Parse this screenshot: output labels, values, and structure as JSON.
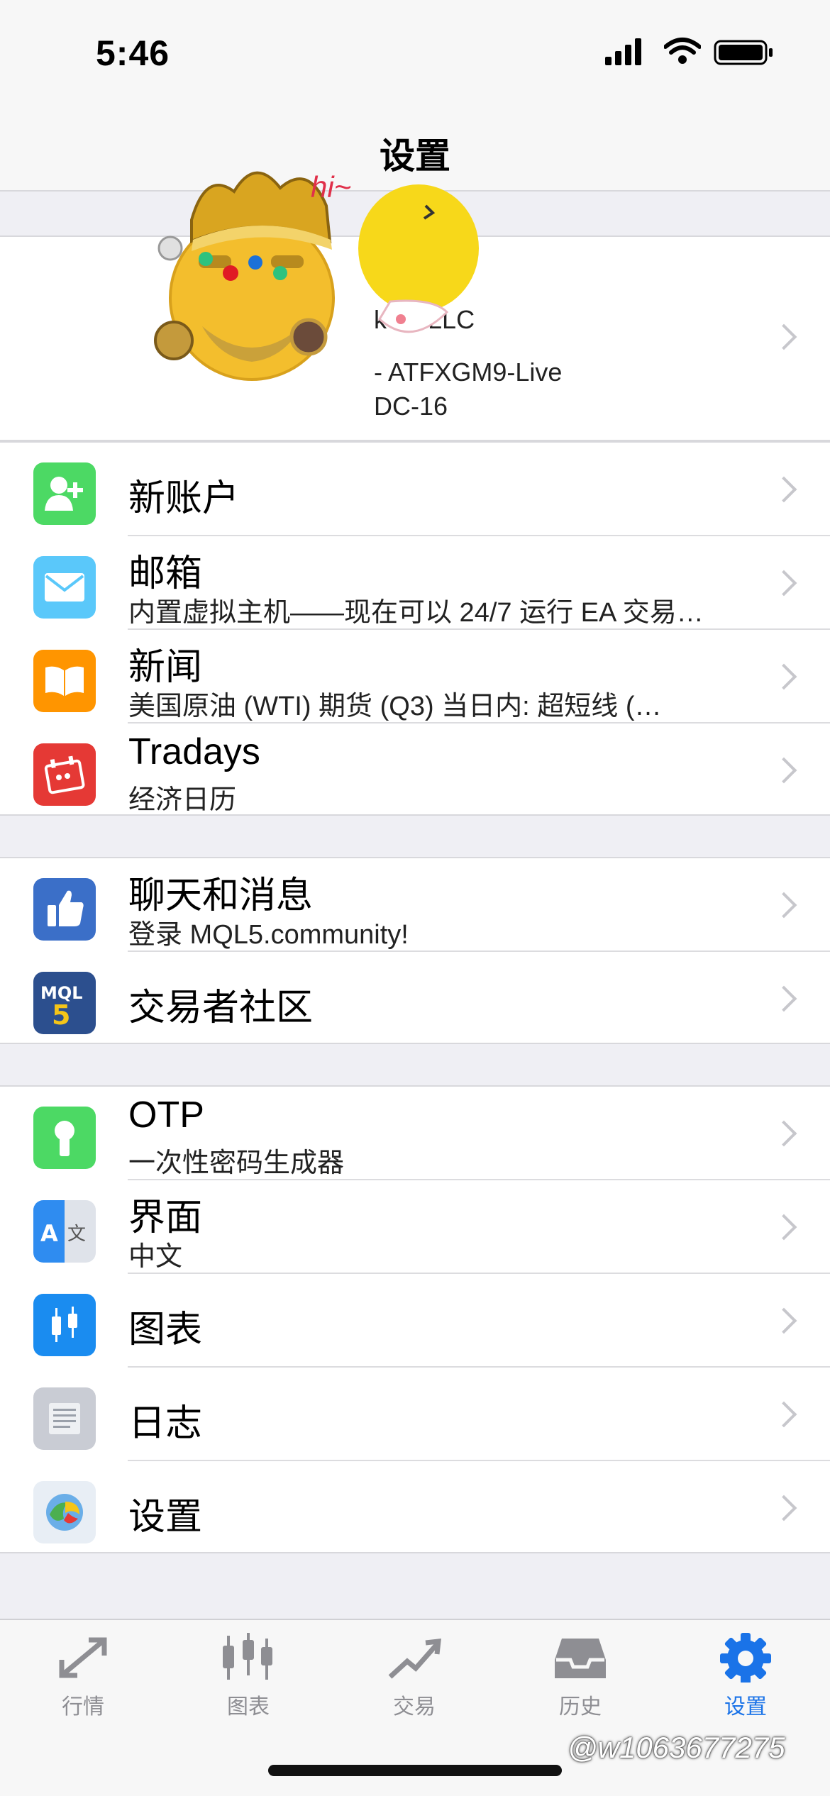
{
  "status": {
    "time": "5:46"
  },
  "nav": {
    "title": "设置"
  },
  "account": {
    "company": "kets LLC",
    "server": "- ATFXGM9-Live",
    "account_id": "DC-16"
  },
  "menu1": [
    {
      "title": "新账户",
      "subtitle": ""
    },
    {
      "title": "邮箱",
      "subtitle": "内置虚拟主机——现在可以 24/7 运行 EA 交易…"
    },
    {
      "title": "新闻",
      "subtitle": "美国原油 (WTI) 期货 (Q3) 当日内: 超短线 (…"
    },
    {
      "title": "Tradays",
      "subtitle": "经济日历"
    }
  ],
  "menu2": [
    {
      "title": "聊天和消息",
      "subtitle": "登录 MQL5.community!"
    },
    {
      "title": "交易者社区",
      "subtitle": ""
    }
  ],
  "menu3": [
    {
      "title": "OTP",
      "subtitle": "一次性密码生成器"
    },
    {
      "title": "界面",
      "subtitle": "中文"
    },
    {
      "title": "图表",
      "subtitle": ""
    },
    {
      "title": "日志",
      "subtitle": ""
    },
    {
      "title": "设置",
      "subtitle": ""
    }
  ],
  "icons": {
    "new_account": "add-user-icon",
    "mail": "mail-icon",
    "news": "book-icon",
    "tradays": "calendar-icon",
    "chat": "thumbs-up-icon",
    "community": "mql5-icon",
    "otp": "keyhole-icon",
    "language": "translate-icon",
    "charts": "candlestick-icon",
    "journal": "document-icon",
    "settings": "metatrader-icon"
  },
  "tabs": [
    {
      "label": "行情",
      "icon": "quotes-icon"
    },
    {
      "label": "图表",
      "icon": "chart-icon"
    },
    {
      "label": "交易",
      "icon": "trade-icon"
    },
    {
      "label": "历史",
      "icon": "history-icon"
    },
    {
      "label": "设置",
      "icon": "gear-icon",
      "active": true
    }
  ],
  "sticker": {
    "text": "hi~"
  },
  "watermark": {
    "text": "@w1063677275"
  },
  "colors": {
    "accent": "#1a73e8",
    "green": "#4cd964",
    "light_blue": "#5ac8fa",
    "orange": "#ff9500",
    "red": "#e53935",
    "indigo": "#3b6fc8",
    "gray": "#c7c7cc"
  }
}
